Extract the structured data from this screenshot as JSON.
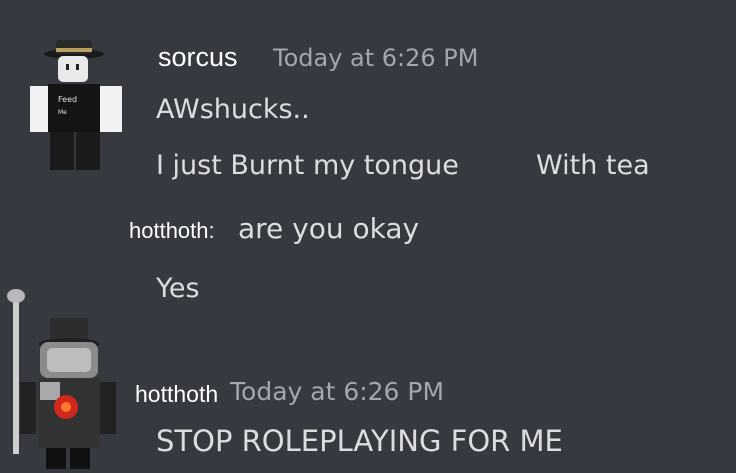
{
  "messages": [
    {
      "author": "sorcus",
      "timestamp": "Today at 6:26 PM",
      "avatar": "roblox-avatar-feed-me-shirt",
      "lines": [
        "AWshucks..",
        "I just Burnt my tongue",
        "With tea"
      ]
    },
    {
      "inline_author": "hotthoth:",
      "text": "are you okay"
    },
    {
      "text": "Yes"
    },
    {
      "author": "hotthoth",
      "timestamp": "Today at 6:26 PM",
      "avatar": "roblox-avatar-top-hat-staff",
      "lines": [
        "STOP ROLEPLAYING FOR ME"
      ]
    }
  ],
  "avatar_shirt_text": [
    "Feed",
    "Me"
  ],
  "colors": {
    "background": "#36393f",
    "username": "#ffffff",
    "timestamp": "#a3a6aa",
    "message_text": "#dcddde"
  }
}
